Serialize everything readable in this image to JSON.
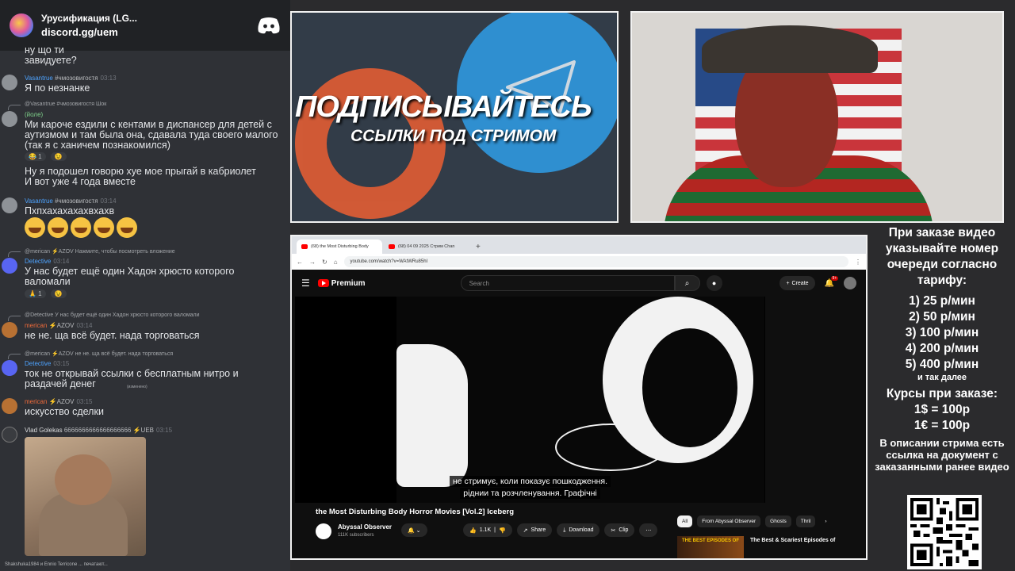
{
  "server": {
    "name": "Урусификация (LG...",
    "link": "discord.gg/uem",
    "logo_icon": "discord-icon"
  },
  "chat": {
    "messages": [
      {
        "text": "ну що ти\nзавидуете?"
      },
      {
        "author": "Vasantrue",
        "tag": "#чмозовигостя",
        "time": "03:13",
        "text": "Я по незнанке"
      },
      {
        "reply": "@Vasantrue #чмозовигостя Шок",
        "author": "(йоле)",
        "time": "",
        "text": "Ми кароче ездили с кентами в диспансер для детей с\nаутизмом и там была она, сдавала туда своего малого\n(так я с ханичем познакомился)",
        "reactions": [
          "😂 1",
          "😉"
        ]
      },
      {
        "text": "Ну я подошел говорю хуе мое прыгай в кабриолет\nИ вот уже 4 года вместе"
      },
      {
        "author": "Vasantrue",
        "tag": "#чмозовигостя",
        "time": "03:14",
        "text": "Пхпхахахахахвхахв"
      },
      {
        "reply": "@merican ⚡AZOV  Нажмите, чтобы посмотреть вложение",
        "author": "Detective",
        "time": "03:14",
        "text": "У нас будет ещё один Хадон хрюсто которого\nваломали",
        "reactions": [
          "🙏 1",
          "😉"
        ]
      },
      {
        "reply": "@Detective У нас будет ещё один Хадон хрюсто которого валомали",
        "author": "merican",
        "tag": "⚡AZOV",
        "time": "03:14",
        "text": "не не. ща всё будет. нада торговаться"
      },
      {
        "reply": "@merican ⚡AZOV не не. ща всё будет. нада торговаться",
        "author": "Detective",
        "time": "03:15",
        "text": "ток не открывай ссылки с бесплатным нитро и\nраздачей денег",
        "edited": "(изменено)"
      },
      {
        "author": "merican",
        "tag": "⚡AZOV",
        "time": "03:15",
        "text": "искусство сделки"
      },
      {
        "author": "Vlad Golekas",
        "tag": "6666666666666666666 ⚡UEB",
        "time": "03:15",
        "text": ""
      }
    ],
    "typing": "Shakshuka1984 и Ennio Terricone ... печатают..."
  },
  "banner": {
    "headline": "ПОДПИСЫВАЙТЕСЬ",
    "subline": "ССЫЛКИ ПОД СТРИМОМ"
  },
  "browser": {
    "tabs": [
      "(68) the Most Disturbing Body",
      "(68) 04 09 2025 Стрим Chan"
    ],
    "url": "youtube.com/watch?v=WAtWRu85hI",
    "yt": {
      "logo": "Premium",
      "search_placeholder": "Search",
      "create": "Create",
      "badge": "9+",
      "subtitles": [
        "не стримує, коли показує пошкодження.",
        "ріднии та розчленування.  Графічні"
      ],
      "title": "the Most Disturbing Body Horror Movies [Vol.2] Iceberg",
      "channel": "Abyssal Observer",
      "subscribers": "111K subscribers",
      "likes": "1.1K",
      "share": "Share",
      "download": "Download",
      "clip": "Clip",
      "chips": [
        "All",
        "From Abyssal Observer",
        "Ghosts",
        "Thril"
      ],
      "rec_title": "The Best & Scariest Episodes of",
      "rec_thumb": "THE BEST EPISODES OF"
    }
  },
  "info": {
    "heading": "При заказе видео указывайте номер очереди согласно тарифу:",
    "tariffs": [
      "1) 25 р/мин",
      "2) 50 р/мин",
      "3) 100 р/мин",
      "4) 200 р/мин",
      "5) 400 р/мин"
    ],
    "etc": "и так далее",
    "rates_title": "Курсы при заказе:",
    "rates": [
      "1$ = 100р",
      "1€ = 100р"
    ],
    "note": "В описании стрима есть ссылка на документ с заказанными ранее видео"
  }
}
